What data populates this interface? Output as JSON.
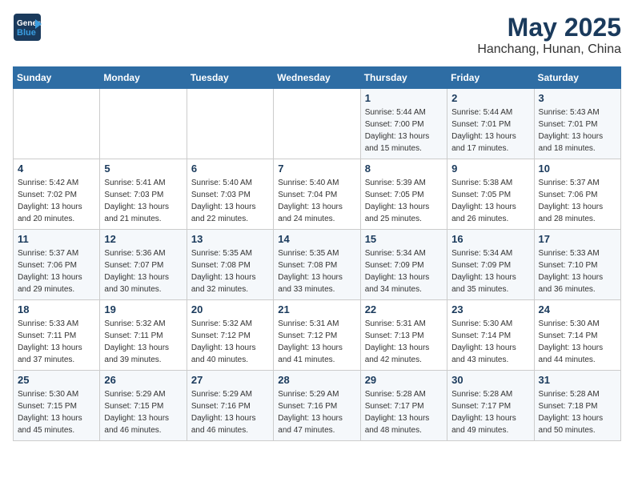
{
  "header": {
    "logo_line1": "General",
    "logo_line2": "Blue",
    "month": "May 2025",
    "location": "Hanchang, Hunan, China"
  },
  "days_of_week": [
    "Sunday",
    "Monday",
    "Tuesday",
    "Wednesday",
    "Thursday",
    "Friday",
    "Saturday"
  ],
  "weeks": [
    [
      {
        "day": "",
        "info": ""
      },
      {
        "day": "",
        "info": ""
      },
      {
        "day": "",
        "info": ""
      },
      {
        "day": "",
        "info": ""
      },
      {
        "day": "1",
        "info": "Sunrise: 5:44 AM\nSunset: 7:00 PM\nDaylight: 13 hours\nand 15 minutes."
      },
      {
        "day": "2",
        "info": "Sunrise: 5:44 AM\nSunset: 7:01 PM\nDaylight: 13 hours\nand 17 minutes."
      },
      {
        "day": "3",
        "info": "Sunrise: 5:43 AM\nSunset: 7:01 PM\nDaylight: 13 hours\nand 18 minutes."
      }
    ],
    [
      {
        "day": "4",
        "info": "Sunrise: 5:42 AM\nSunset: 7:02 PM\nDaylight: 13 hours\nand 20 minutes."
      },
      {
        "day": "5",
        "info": "Sunrise: 5:41 AM\nSunset: 7:03 PM\nDaylight: 13 hours\nand 21 minutes."
      },
      {
        "day": "6",
        "info": "Sunrise: 5:40 AM\nSunset: 7:03 PM\nDaylight: 13 hours\nand 22 minutes."
      },
      {
        "day": "7",
        "info": "Sunrise: 5:40 AM\nSunset: 7:04 PM\nDaylight: 13 hours\nand 24 minutes."
      },
      {
        "day": "8",
        "info": "Sunrise: 5:39 AM\nSunset: 7:05 PM\nDaylight: 13 hours\nand 25 minutes."
      },
      {
        "day": "9",
        "info": "Sunrise: 5:38 AM\nSunset: 7:05 PM\nDaylight: 13 hours\nand 26 minutes."
      },
      {
        "day": "10",
        "info": "Sunrise: 5:37 AM\nSunset: 7:06 PM\nDaylight: 13 hours\nand 28 minutes."
      }
    ],
    [
      {
        "day": "11",
        "info": "Sunrise: 5:37 AM\nSunset: 7:06 PM\nDaylight: 13 hours\nand 29 minutes."
      },
      {
        "day": "12",
        "info": "Sunrise: 5:36 AM\nSunset: 7:07 PM\nDaylight: 13 hours\nand 30 minutes."
      },
      {
        "day": "13",
        "info": "Sunrise: 5:35 AM\nSunset: 7:08 PM\nDaylight: 13 hours\nand 32 minutes."
      },
      {
        "day": "14",
        "info": "Sunrise: 5:35 AM\nSunset: 7:08 PM\nDaylight: 13 hours\nand 33 minutes."
      },
      {
        "day": "15",
        "info": "Sunrise: 5:34 AM\nSunset: 7:09 PM\nDaylight: 13 hours\nand 34 minutes."
      },
      {
        "day": "16",
        "info": "Sunrise: 5:34 AM\nSunset: 7:09 PM\nDaylight: 13 hours\nand 35 minutes."
      },
      {
        "day": "17",
        "info": "Sunrise: 5:33 AM\nSunset: 7:10 PM\nDaylight: 13 hours\nand 36 minutes."
      }
    ],
    [
      {
        "day": "18",
        "info": "Sunrise: 5:33 AM\nSunset: 7:11 PM\nDaylight: 13 hours\nand 37 minutes."
      },
      {
        "day": "19",
        "info": "Sunrise: 5:32 AM\nSunset: 7:11 PM\nDaylight: 13 hours\nand 39 minutes."
      },
      {
        "day": "20",
        "info": "Sunrise: 5:32 AM\nSunset: 7:12 PM\nDaylight: 13 hours\nand 40 minutes."
      },
      {
        "day": "21",
        "info": "Sunrise: 5:31 AM\nSunset: 7:12 PM\nDaylight: 13 hours\nand 41 minutes."
      },
      {
        "day": "22",
        "info": "Sunrise: 5:31 AM\nSunset: 7:13 PM\nDaylight: 13 hours\nand 42 minutes."
      },
      {
        "day": "23",
        "info": "Sunrise: 5:30 AM\nSunset: 7:14 PM\nDaylight: 13 hours\nand 43 minutes."
      },
      {
        "day": "24",
        "info": "Sunrise: 5:30 AM\nSunset: 7:14 PM\nDaylight: 13 hours\nand 44 minutes."
      }
    ],
    [
      {
        "day": "25",
        "info": "Sunrise: 5:30 AM\nSunset: 7:15 PM\nDaylight: 13 hours\nand 45 minutes."
      },
      {
        "day": "26",
        "info": "Sunrise: 5:29 AM\nSunset: 7:15 PM\nDaylight: 13 hours\nand 46 minutes."
      },
      {
        "day": "27",
        "info": "Sunrise: 5:29 AM\nSunset: 7:16 PM\nDaylight: 13 hours\nand 46 minutes."
      },
      {
        "day": "28",
        "info": "Sunrise: 5:29 AM\nSunset: 7:16 PM\nDaylight: 13 hours\nand 47 minutes."
      },
      {
        "day": "29",
        "info": "Sunrise: 5:28 AM\nSunset: 7:17 PM\nDaylight: 13 hours\nand 48 minutes."
      },
      {
        "day": "30",
        "info": "Sunrise: 5:28 AM\nSunset: 7:17 PM\nDaylight: 13 hours\nand 49 minutes."
      },
      {
        "day": "31",
        "info": "Sunrise: 5:28 AM\nSunset: 7:18 PM\nDaylight: 13 hours\nand 50 minutes."
      }
    ]
  ]
}
